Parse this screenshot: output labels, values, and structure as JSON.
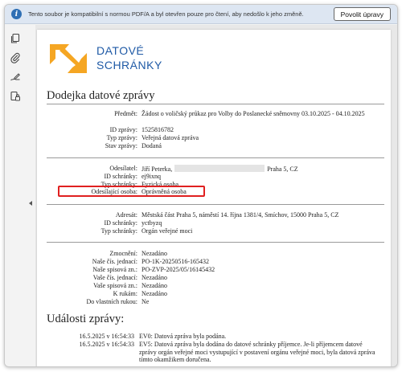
{
  "infobar": {
    "message": "Tento soubor je kompatibilní s normou PDF/A a byl otevřen pouze pro čtení, aby nedošlo k jeho změně.",
    "enable_button": "Povolit úpravy"
  },
  "sidebar": {
    "icons": [
      "copy-pages-icon",
      "attachment-icon",
      "signature-icon",
      "security-icon"
    ]
  },
  "logo": {
    "line1": "DATOVÉ",
    "line2": "SCHRÁNKY"
  },
  "document": {
    "title": "Dodejka datové zprávy",
    "message_info": [
      {
        "label": "Předmět:",
        "value": "Žádost o voličský průkaz pro Volby do Poslanecké sněmovny 03.10.2025 - 04.10.2025"
      },
      {
        "label": "ID zprávy:",
        "value": "1525816782"
      },
      {
        "label": "Typ zprávy:",
        "value": "Veřejná datová zpráva"
      },
      {
        "label": "Stav zprávy:",
        "value": "Dodaná"
      }
    ],
    "sender": {
      "label": "Odesílatel:",
      "name": "Jiří Peterka,",
      "address_end": "Praha 5, CZ",
      "rows": [
        {
          "label": "ID schránky:",
          "value": "ej9ixnq"
        },
        {
          "label": "Typ schránky:",
          "value": "Fyzická osoba"
        },
        {
          "label": "Odesílající osoba:",
          "value": "Oprávněná osoba"
        }
      ]
    },
    "recipient": [
      {
        "label": "Adresát:",
        "value": "Městská část Praha 5, náměstí 14. října 1381/4, Smíchov, 15000 Praha 5, CZ"
      },
      {
        "label": "ID schránky:",
        "value": "yctbyzq"
      },
      {
        "label": "Typ schránky:",
        "value": "Orgán veřejné moci"
      }
    ],
    "details": [
      {
        "label": "Zmocnění:",
        "value": "Nezadáno"
      },
      {
        "label": "Naše čís. jednací:",
        "value": "PO-1K-20250516-165432"
      },
      {
        "label": "Naše spisová zn.:",
        "value": "PO-ZVP-2025/05/16145432"
      },
      {
        "label": "Vaše čís. jednací:",
        "value": "Nezadáno"
      },
      {
        "label": "Vaše spisová zn.:",
        "value": "Nezadáno"
      },
      {
        "label": "K rukám:",
        "value": "Nezadáno"
      },
      {
        "label": "Do vlastních rukou:",
        "value": "Ne"
      }
    ],
    "events_title": "Události zprávy:",
    "events": [
      {
        "time": "16.5.2025 v 16:54:33",
        "text": "EV0: Datová zpráva byla podána."
      },
      {
        "time": "16.5.2025 v 16:54:33",
        "text": "EV5: Datová zpráva byla dodána do datové schránky příjemce. Je-li příjemcem datové zprávy orgán veřejné moci vystupující v postavení orgánu veřejné moci, byla datová zpráva tímto okamžikem doručena."
      }
    ]
  }
}
